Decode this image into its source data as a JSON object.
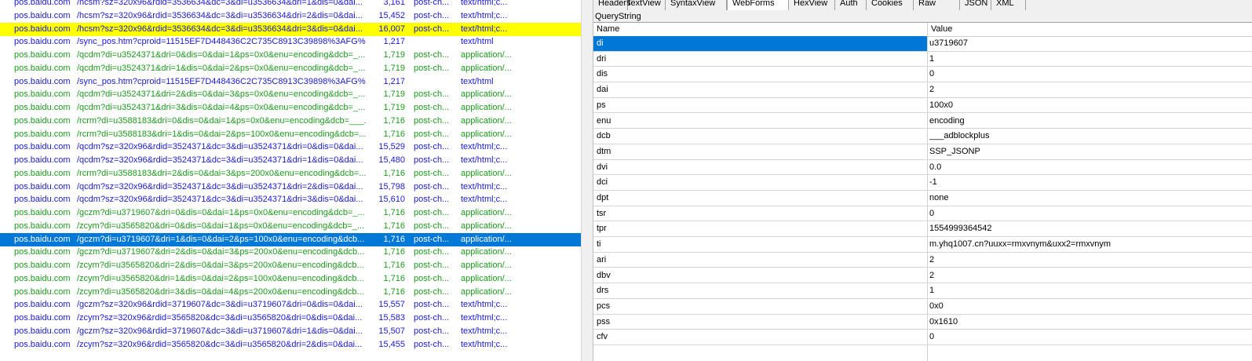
{
  "sessions": [
    {
      "host": "pos.baidu.com",
      "url": "/hcsm?sz=320x96&rdid=3536634&dc=3&di=u3536634&dri=1&dis=0&dai...",
      "body": "3,161",
      "caching": "post-ch...",
      "ctype": "text/html;c...",
      "color": "blue",
      "highlight": "none"
    },
    {
      "host": "pos.baidu.com",
      "url": "/hcsm?sz=320x96&rdid=3536634&dc=3&di=u3536634&dri=2&dis=0&dai...",
      "body": "15,452",
      "caching": "post-ch...",
      "ctype": "text/html;c...",
      "color": "blue",
      "highlight": "none"
    },
    {
      "host": "pos.baidu.com",
      "url": "/hcsm?sz=320x96&rdid=3536634&dc=3&di=u3536634&dri=3&dis=0&dai...",
      "body": "16,007",
      "caching": "post-ch...",
      "ctype": "text/html;c...",
      "color": "blue",
      "highlight": "yellow"
    },
    {
      "host": "pos.baidu.com",
      "url": "/sync_pos.htm?cproid=11515EF7D448436C2C735C8913C39898%3AFG%...",
      "body": "1,217",
      "caching": "",
      "ctype": "text/html",
      "color": "blue",
      "highlight": "none"
    },
    {
      "host": "pos.baidu.com",
      "url": "/qcdm?di=u3524371&dri=0&dis=0&dai=1&ps=0x0&enu=encoding&dcb=_...",
      "body": "1,719",
      "caching": "post-ch...",
      "ctype": "application/...",
      "color": "green",
      "highlight": "none"
    },
    {
      "host": "pos.baidu.com",
      "url": "/qcdm?di=u3524371&dri=1&dis=0&dai=2&ps=0x0&enu=encoding&dcb=_...",
      "body": "1,719",
      "caching": "post-ch...",
      "ctype": "application/...",
      "color": "green",
      "highlight": "none"
    },
    {
      "host": "pos.baidu.com",
      "url": "/sync_pos.htm?cproid=11515EF7D448436C2C735C8913C39898%3AFG%...",
      "body": "1,217",
      "caching": "",
      "ctype": "text/html",
      "color": "blue",
      "highlight": "none"
    },
    {
      "host": "pos.baidu.com",
      "url": "/qcdm?di=u3524371&dri=2&dis=0&dai=3&ps=0x0&enu=encoding&dcb=_...",
      "body": "1,719",
      "caching": "post-ch...",
      "ctype": "application/...",
      "color": "green",
      "highlight": "none"
    },
    {
      "host": "pos.baidu.com",
      "url": "/qcdm?di=u3524371&dri=3&dis=0&dai=4&ps=0x0&enu=encoding&dcb=_...",
      "body": "1,719",
      "caching": "post-ch...",
      "ctype": "application/...",
      "color": "green",
      "highlight": "none"
    },
    {
      "host": "pos.baidu.com",
      "url": "/rcrm?di=u3588183&dri=0&dis=0&dai=1&ps=0x0&enu=encoding&dcb=___...",
      "body": "1,716",
      "caching": "post-ch...",
      "ctype": "application/...",
      "color": "green",
      "highlight": "none"
    },
    {
      "host": "pos.baidu.com",
      "url": "/rcrm?di=u3588183&dri=1&dis=0&dai=2&ps=100x0&enu=encoding&dcb=...",
      "body": "1,716",
      "caching": "post-ch...",
      "ctype": "application/...",
      "color": "green",
      "highlight": "none"
    },
    {
      "host": "pos.baidu.com",
      "url": "/qcdm?sz=320x96&rdid=3524371&dc=3&di=u3524371&dri=0&dis=0&dai...",
      "body": "15,529",
      "caching": "post-ch...",
      "ctype": "text/html;c...",
      "color": "blue",
      "highlight": "none"
    },
    {
      "host": "pos.baidu.com",
      "url": "/qcdm?sz=320x96&rdid=3524371&dc=3&di=u3524371&dri=1&dis=0&dai...",
      "body": "15,480",
      "caching": "post-ch...",
      "ctype": "text/html;c...",
      "color": "blue",
      "highlight": "none"
    },
    {
      "host": "pos.baidu.com",
      "url": "/rcrm?di=u3588183&dri=2&dis=0&dai=3&ps=200x0&enu=encoding&dcb=...",
      "body": "1,716",
      "caching": "post-ch...",
      "ctype": "application/...",
      "color": "green",
      "highlight": "none"
    },
    {
      "host": "pos.baidu.com",
      "url": "/qcdm?sz=320x96&rdid=3524371&dc=3&di=u3524371&dri=2&dis=0&dai...",
      "body": "15,798",
      "caching": "post-ch...",
      "ctype": "text/html;c...",
      "color": "blue",
      "highlight": "none"
    },
    {
      "host": "pos.baidu.com",
      "url": "/qcdm?sz=320x96&rdid=3524371&dc=3&di=u3524371&dri=3&dis=0&dai...",
      "body": "15,610",
      "caching": "post-ch...",
      "ctype": "text/html;c...",
      "color": "blue",
      "highlight": "none"
    },
    {
      "host": "pos.baidu.com",
      "url": "/gczm?di=u3719607&dri=0&dis=0&dai=1&ps=0x0&enu=encoding&dcb=_...",
      "body": "1,716",
      "caching": "post-ch...",
      "ctype": "application/...",
      "color": "green",
      "highlight": "none"
    },
    {
      "host": "pos.baidu.com",
      "url": "/zcym?di=u3565820&dri=0&dis=0&dai=1&ps=0x0&enu=encoding&dcb=_...",
      "body": "1,716",
      "caching": "post-ch...",
      "ctype": "application/...",
      "color": "green",
      "highlight": "none"
    },
    {
      "host": "pos.baidu.com",
      "url": "/gczm?di=u3719607&dri=1&dis=0&dai=2&ps=100x0&enu=encoding&dcb...",
      "body": "1,716",
      "caching": "post-ch...",
      "ctype": "application/...",
      "color": "green",
      "highlight": "selected"
    },
    {
      "host": "pos.baidu.com",
      "url": "/gczm?di=u3719607&dri=2&dis=0&dai=3&ps=200x0&enu=encoding&dcb...",
      "body": "1,716",
      "caching": "post-ch...",
      "ctype": "application/...",
      "color": "green",
      "highlight": "none"
    },
    {
      "host": "pos.baidu.com",
      "url": "/zcym?di=u3565820&dri=2&dis=0&dai=3&ps=200x0&enu=encoding&dcb...",
      "body": "1,716",
      "caching": "post-ch...",
      "ctype": "application/...",
      "color": "green",
      "highlight": "none"
    },
    {
      "host": "pos.baidu.com",
      "url": "/zcym?di=u3565820&dri=1&dis=0&dai=2&ps=100x0&enu=encoding&dcb...",
      "body": "1,716",
      "caching": "post-ch...",
      "ctype": "application/...",
      "color": "green",
      "highlight": "none"
    },
    {
      "host": "pos.baidu.com",
      "url": "/zcym?di=u3565820&dri=3&dis=0&dai=4&ps=200x0&enu=encoding&dcb...",
      "body": "1,716",
      "caching": "post-ch...",
      "ctype": "application/...",
      "color": "green",
      "highlight": "none"
    },
    {
      "host": "pos.baidu.com",
      "url": "/gczm?sz=320x96&rdid=3719607&dc=3&di=u3719607&dri=0&dis=0&dai...",
      "body": "15,557",
      "caching": "post-ch...",
      "ctype": "text/html;c...",
      "color": "blue",
      "highlight": "none"
    },
    {
      "host": "pos.baidu.com",
      "url": "/zcym?sz=320x96&rdid=3565820&dc=3&di=u3565820&dri=0&dis=0&dai...",
      "body": "15,583",
      "caching": "post-ch...",
      "ctype": "text/html;c...",
      "color": "blue",
      "highlight": "none"
    },
    {
      "host": "pos.baidu.com",
      "url": "/gczm?sz=320x96&rdid=3719607&dc=3&di=u3719607&dri=1&dis=0&dai...",
      "body": "15,507",
      "caching": "post-ch...",
      "ctype": "text/html;c...",
      "color": "blue",
      "highlight": "none"
    },
    {
      "host": "pos.baidu.com",
      "url": "/zcym?sz=320x96&rdid=3565820&dc=3&di=u3565820&dri=2&dis=0&dai...",
      "body": "15,455",
      "caching": "post-ch...",
      "ctype": "text/html;c...",
      "color": "blue",
      "highlight": "none"
    }
  ],
  "inspector": {
    "tabs": [
      "Headers",
      "TextView",
      "SyntaxView",
      "WebForms",
      "HexView",
      "Auth",
      "Cookies",
      "Raw",
      "JSON",
      "XML"
    ],
    "active_tab": "WebForms",
    "section_label": "QueryString",
    "columns": {
      "name": "Name",
      "value": "Value"
    },
    "params": [
      {
        "name": "di",
        "value": "u3719607"
      },
      {
        "name": "dri",
        "value": "1"
      },
      {
        "name": "dis",
        "value": "0"
      },
      {
        "name": "dai",
        "value": "2"
      },
      {
        "name": "ps",
        "value": "100x0"
      },
      {
        "name": "enu",
        "value": "encoding"
      },
      {
        "name": "dcb",
        "value": "___adblockplus"
      },
      {
        "name": "dtm",
        "value": "SSP_JSONP"
      },
      {
        "name": "dvi",
        "value": "0.0"
      },
      {
        "name": "dci",
        "value": "-1"
      },
      {
        "name": "dpt",
        "value": "none"
      },
      {
        "name": "tsr",
        "value": "0"
      },
      {
        "name": "tpr",
        "value": "1554999364542"
      },
      {
        "name": "ti",
        "value": "m.yhq1007.cn?uuxx=rmxvnym&uxx2=rmxvnym"
      },
      {
        "name": "ari",
        "value": "2"
      },
      {
        "name": "dbv",
        "value": "2"
      },
      {
        "name": "drs",
        "value": "1"
      },
      {
        "name": "pcs",
        "value": "0x0"
      },
      {
        "name": "pss",
        "value": "0x1610"
      },
      {
        "name": "cfv",
        "value": "0"
      }
    ]
  }
}
